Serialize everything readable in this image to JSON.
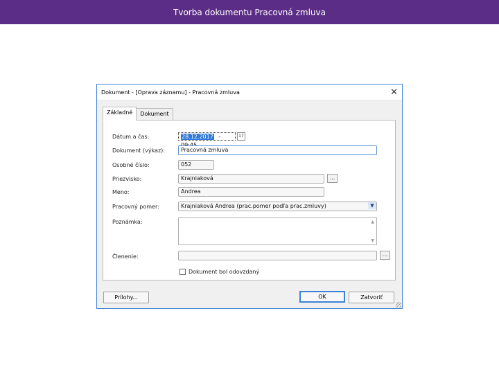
{
  "slide": {
    "title": "Tvorba dokumentu Pracovná zmluva"
  },
  "dialog": {
    "title": "Dokument - [Oprava záznamu] - Pracovná zmluva",
    "tabs": [
      {
        "label": "Základné"
      },
      {
        "label": "Dokument"
      }
    ],
    "labels": {
      "datetime": "Dátum a čas:",
      "document": "Dokument (výkaz):",
      "personal_number": "Osobné číslo:",
      "surname": "Priezvisko:",
      "name": "Meno:",
      "employment": "Pracovný pomer:",
      "note": "Poznámka:",
      "division": "Členenie:"
    },
    "values": {
      "date": "28.12.2017",
      "time": "- 09:45",
      "document": "Pracovná zmluva",
      "personal_number": "052",
      "surname": "Krajniaková",
      "name": "Andrea",
      "employment": "Krajniaková Andrea (prac.pomer podľa prac.zmluvy)",
      "note": "",
      "division": ""
    },
    "checkbox": {
      "label": "Dokument bol odovzdaný",
      "checked": false
    },
    "buttons": {
      "attachments": "Prílohy...",
      "ok": "OK",
      "close": "Zatvoriť",
      "browse": "..."
    },
    "icons": {
      "close": "close-icon",
      "calendar": "calendar-icon",
      "dropdown": "chevron-down-icon"
    }
  }
}
